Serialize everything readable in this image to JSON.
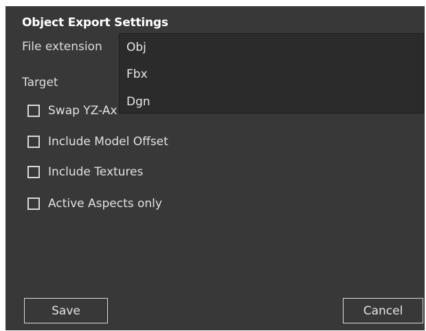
{
  "dialog": {
    "title": "Object Export Settings",
    "file_extension_label": "File extension",
    "target_label": "Target",
    "file_extension_options": [
      "Obj",
      "Fbx",
      "Dgn"
    ],
    "options": [
      {
        "label": "Swap YZ-Ax",
        "checked": false
      },
      {
        "label": "Include Model Offset",
        "checked": false
      },
      {
        "label": "Include Textures",
        "checked": false
      },
      {
        "label": "Active Aspects only",
        "checked": false
      }
    ],
    "save_label": "Save",
    "cancel_label": "Cancel"
  },
  "colors": {
    "dialog_bg": "#383838",
    "dropdown_bg": "#2b2b2b",
    "text": "#e2e2e2",
    "border": "#dcdcdc"
  }
}
